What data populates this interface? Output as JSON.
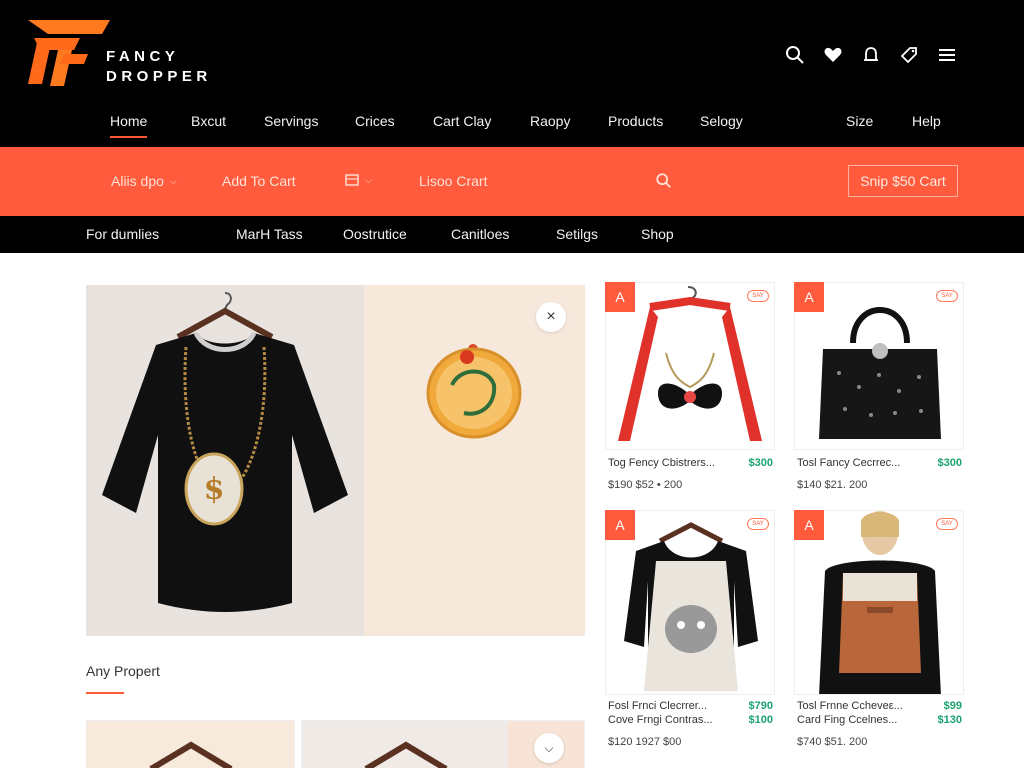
{
  "brand": {
    "line1": "FANCY",
    "line2": "DROPPER",
    "accent_color": "#ff5b3c"
  },
  "header_icons": [
    {
      "icon": "search-icon"
    },
    {
      "icon": "heart-icon"
    },
    {
      "icon": "bell-icon"
    },
    {
      "icon": "tag-icon"
    },
    {
      "icon": "menu-icon"
    }
  ],
  "main_nav": {
    "items": [
      "Home",
      "Bxcut",
      "Servings",
      "Crices",
      "Cart Clay",
      "Raopy",
      "Products",
      "Selogy",
      "Size",
      "Help"
    ],
    "active": "Home"
  },
  "orange_bar": {
    "dropdown_1": "Aliis dpo",
    "add_to_cart": "Add To Cart",
    "dropdown_2": "",
    "link": "Lisoo Crart",
    "cta": "Snip $50 Cart"
  },
  "sub_nav": {
    "items": [
      "For dumlies",
      "MarH Tass",
      "Oostrutice",
      "Canitloes",
      "Setilgs",
      "Shop"
    ]
  },
  "hero": {
    "close_label": "×"
  },
  "section": {
    "title": "Any Propert"
  },
  "products": [
    {
      "badge": "A",
      "tag": "SAY",
      "name": "Tog Fency Cbistrers...",
      "price": "$300",
      "meta": "$190 $52 • 200"
    },
    {
      "badge": "A",
      "tag": "SAY",
      "name": "Tosl Fancy Cecrrec...",
      "price": "$300",
      "meta": "$140 $21. 200"
    },
    {
      "badge": "A",
      "tag": "SAY",
      "name": "Fosl Frnci Clecrrer...",
      "price": "$790",
      "name2": "Cove Frngi Contras...",
      "price2": "$100",
      "meta": "$120 1927 $00"
    },
    {
      "badge": "A",
      "tag": "SAY",
      "name": "Tosl Frnne Ccheveε...",
      "price": "$99",
      "name2": "Card Fing Ccelnes...",
      "price2": "$130",
      "meta": "$740 $51. 200"
    }
  ]
}
